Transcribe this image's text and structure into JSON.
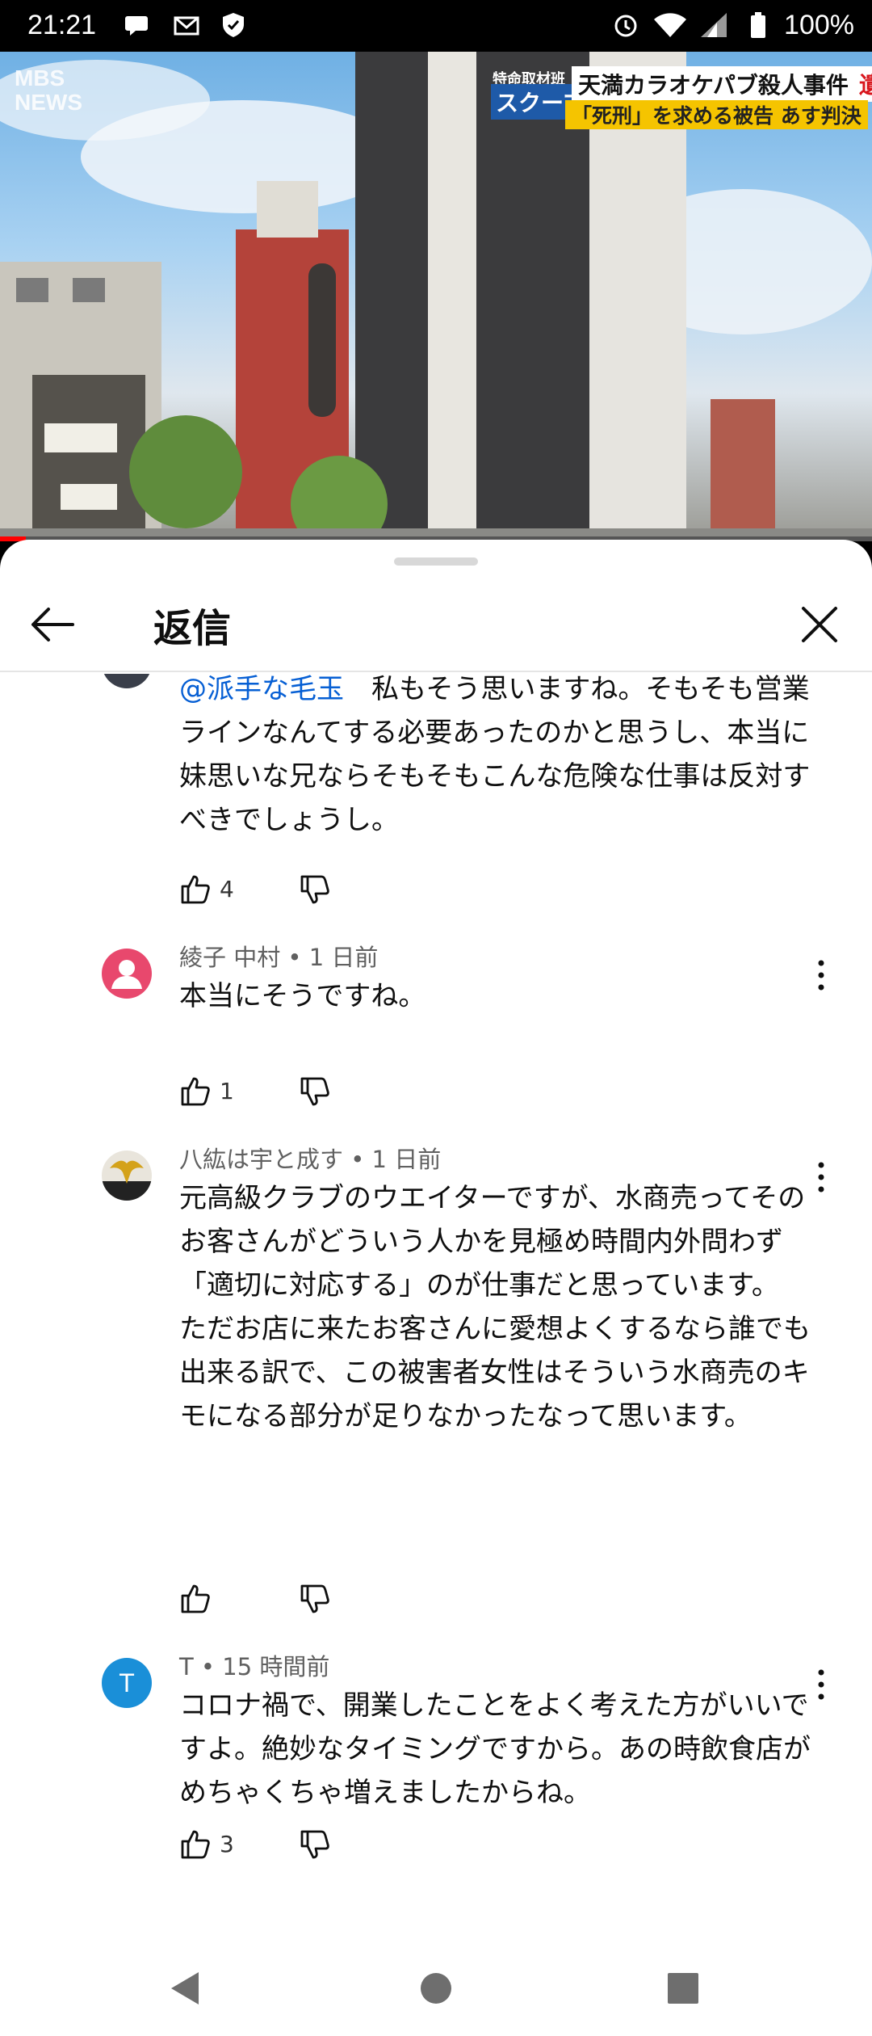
{
  "status_bar": {
    "time": "21:21",
    "battery": "100%",
    "icons": [
      "chat-bubble-icon",
      "mail-icon",
      "shield-icon",
      "alarm-icon",
      "wifi-icon",
      "signal-icon",
      "battery-icon"
    ]
  },
  "video": {
    "channel_logo": "MBS NEWS",
    "badge_small": "特命取材班",
    "badge_large": "スクープ",
    "headline": "天満カラオケパブ殺人事件",
    "headline_tag": "遺族の思い",
    "subheadline": "「死刑」を求める被告 あす判決",
    "progress": 0.03
  },
  "sheet": {
    "title": "返信"
  },
  "comments": [
    {
      "mention": "@派手な毛玉",
      "body": "　私もそう思いますね。そもそも営業ラインなんてする必要あったのかと思うし、本当に妹思いな兄ならそもそもこんな危険な仕事は反対すべきでしょうし。",
      "likes": "4"
    },
    {
      "author": "綾子 中村",
      "time": "1 日前",
      "meta": "綾子 中村 • 1 日前",
      "body": "本当にそうですね。",
      "likes": "1",
      "avatar_color": "#e8486d"
    },
    {
      "author": "八紘は宇と成す",
      "time": "1 日前",
      "meta": "八紘は宇と成す • 1 日前",
      "body": "元高級クラブのウエイターですが、水商売ってそのお客さんがどういう人かを見極め時間内外問わず「適切に対応する」のが仕事だと思っています。\nただお店に来たお客さんに愛想よくするなら誰でも出来る訳で、この被害者女性はそういう水商売のキモになる部分が足りなかったなって思います。",
      "likes": ""
    },
    {
      "author": "T",
      "time": "15 時間前",
      "meta": "T • 15 時間前",
      "avatar_letter": "T",
      "avatar_color": "#1a8fd8",
      "body": "コロナ禍で、開業したことをよく考えた方がいいですよ。絶妙なタイミングですから。あの時飲食店がめちゃくちゃ増えましたからね。",
      "likes": "3"
    }
  ],
  "nav": {
    "icons": [
      "back-triangle-icon",
      "home-circle-icon",
      "recents-square-icon"
    ]
  }
}
